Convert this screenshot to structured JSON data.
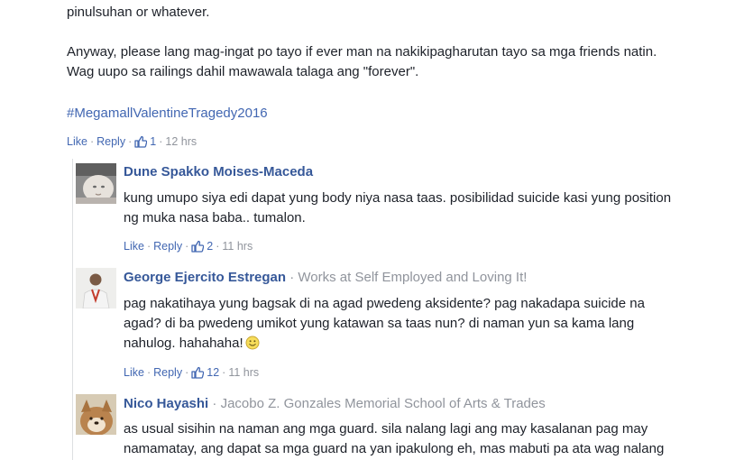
{
  "post": {
    "lines": [
      "pinulsuhan or whatever.",
      "Anyway, please lang mag-ingat po tayo if ever man na nakikipagharutan tayo sa mga friends natin.",
      "Wag uupo sa railings dahil mawawala talaga ang \"forever\"."
    ],
    "hashtag": "#MegamallValentineTragedy2016",
    "actions": {
      "like": "Like",
      "reply": "Reply",
      "likes": "1",
      "time": "12 hrs"
    }
  },
  "replies": [
    {
      "author": "Dune Spakko Moises-Maceda",
      "workplace": "",
      "lines": [
        "kung umupo siya edi dapat yung body niya nasa taas. posibilidad suicide kasi yung position",
        "ng muka nasa baba.. tumalon."
      ],
      "actions": {
        "like": "Like",
        "reply": "Reply",
        "likes": "2",
        "time": "11 hrs"
      }
    },
    {
      "author": "George Ejercito Estregan",
      "workplace": "Works at Self Employed and Loving It!",
      "lines": [
        "pag nakatihaya yung bagsak di na agad pwedeng aksidente? pag nakadapa suicide na",
        "agad? di ba pwedeng umikot yung katawan sa taas nun? di naman yun sa kama lang",
        "nahulog. hahahaha!"
      ],
      "emoji": "smile-emoji",
      "actions": {
        "like": "Like",
        "reply": "Reply",
        "likes": "12",
        "time": "11 hrs"
      }
    },
    {
      "author": "Nico Hayashi",
      "workplace": "Jacobo Z. Gonzales Memorial School of Arts & Trades",
      "lines": [
        "as usual sisihin na naman ang mga guard. sila nalang lagi ang may kasalanan pag may",
        "namamatay, ang dapat sa mga guard na yan ipakulong eh, mas mabuti pa ata wag nalang"
      ]
    }
  ],
  "colors": {
    "link": "#4267b2",
    "name": "#365899",
    "meta": "#90949c",
    "text": "#1d2129"
  }
}
